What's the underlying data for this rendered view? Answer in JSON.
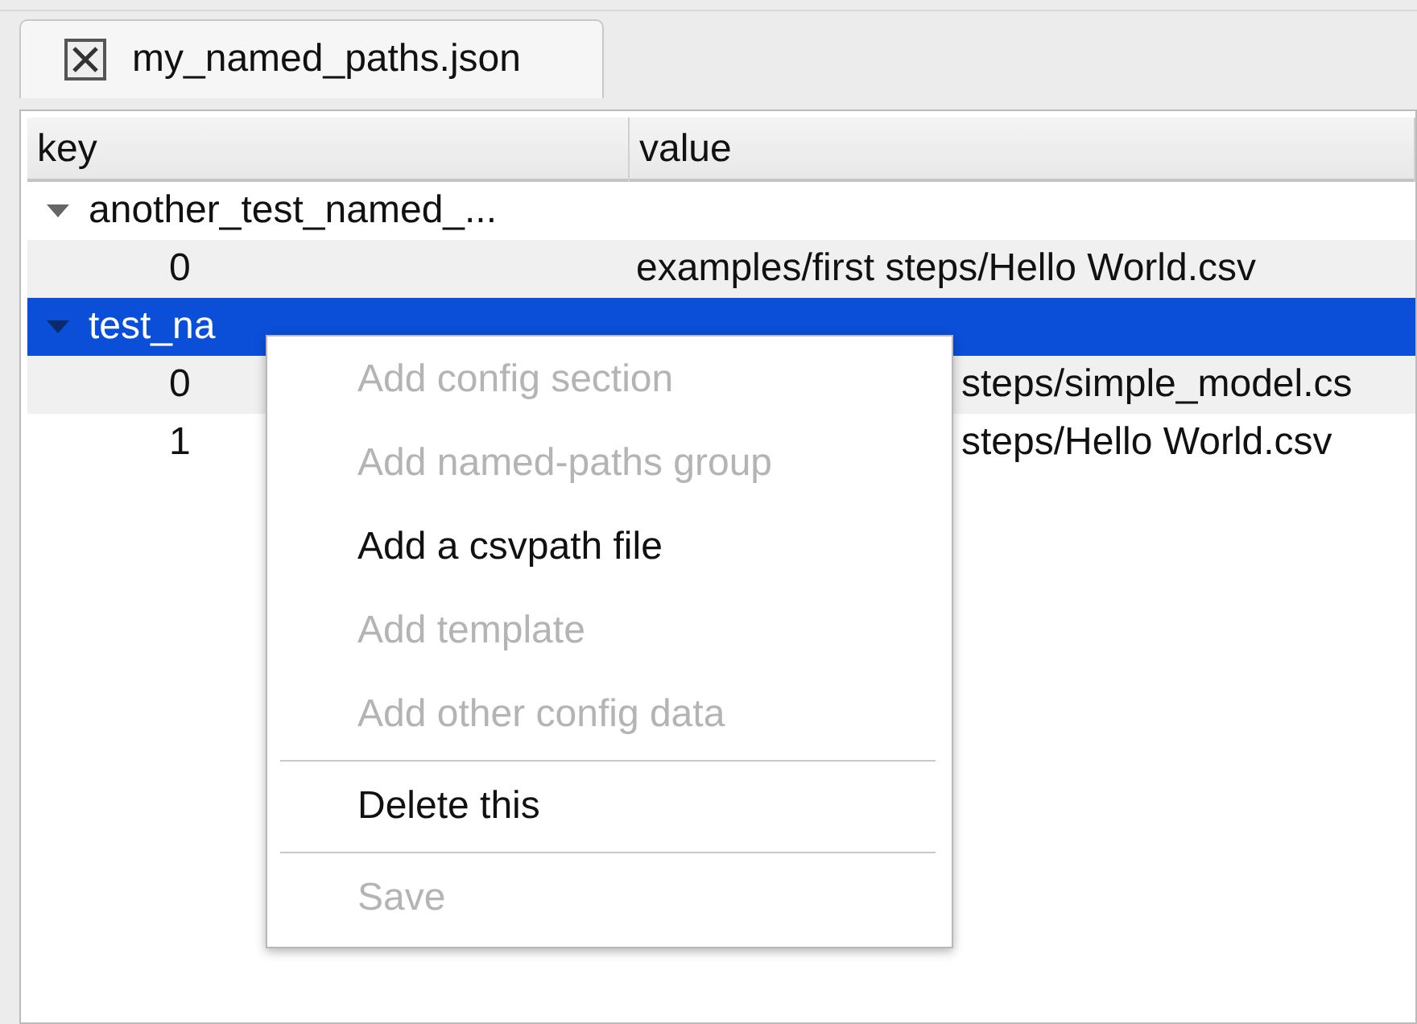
{
  "tabs": [
    {
      "label": "my_named_paths.json",
      "selected": true
    }
  ],
  "tree": {
    "columns": [
      "key",
      "value"
    ],
    "groups": [
      {
        "key": "another_test_named_...",
        "expanded": true,
        "selected": false,
        "children": [
          {
            "key": "0",
            "value": "examples/first steps/Hello World.csv",
            "covered": false
          }
        ]
      },
      {
        "key": "test_na",
        "expanded": true,
        "selected": true,
        "children": [
          {
            "key": "0",
            "value": "steps/simple_model.cs",
            "covered": true
          },
          {
            "key": "1",
            "value": "steps/Hello World.csv",
            "covered": true
          }
        ]
      }
    ]
  },
  "context_menu": {
    "items": [
      {
        "kind": "item",
        "label": "Add config section",
        "disabled": true
      },
      {
        "kind": "item",
        "label": "Add named-paths group",
        "disabled": true
      },
      {
        "kind": "item",
        "label": "Add a csvpath file",
        "disabled": false
      },
      {
        "kind": "item",
        "label": "Add template",
        "disabled": true
      },
      {
        "kind": "item",
        "label": "Add other config data",
        "disabled": true
      },
      {
        "kind": "separator"
      },
      {
        "kind": "item",
        "label": "Delete this",
        "disabled": false
      },
      {
        "kind": "separator"
      },
      {
        "kind": "item",
        "label": "Save",
        "disabled": true
      }
    ]
  }
}
